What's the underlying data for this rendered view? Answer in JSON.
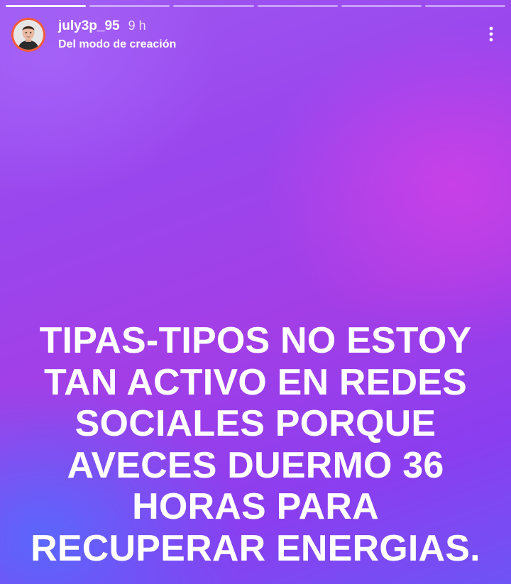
{
  "story": {
    "progress": {
      "segments": 6,
      "active_index": 0
    },
    "header": {
      "username": "july3p_95",
      "time": "9 h",
      "subtitle": "Del modo de creación",
      "avatar_icon": "profile-photo",
      "more_icon": "vertical-ellipsis-icon"
    },
    "caption": {
      "lines": [
        "TIPAS-TIPOS NO ESTOY",
        "TAN ACTIVO EN REDES",
        "SOCIALES PORQUE",
        "AVECES DUERMO 36",
        "HORAS PARA",
        "RECUPERAR ENERGIAS."
      ]
    },
    "colors": {
      "gradient_top_left": "#a96ef8",
      "gradient_right": "#d040e6",
      "gradient_bottom_left": "#5a72f8",
      "avatar_ring": "#f25a3a",
      "text": "#ffffff"
    }
  }
}
